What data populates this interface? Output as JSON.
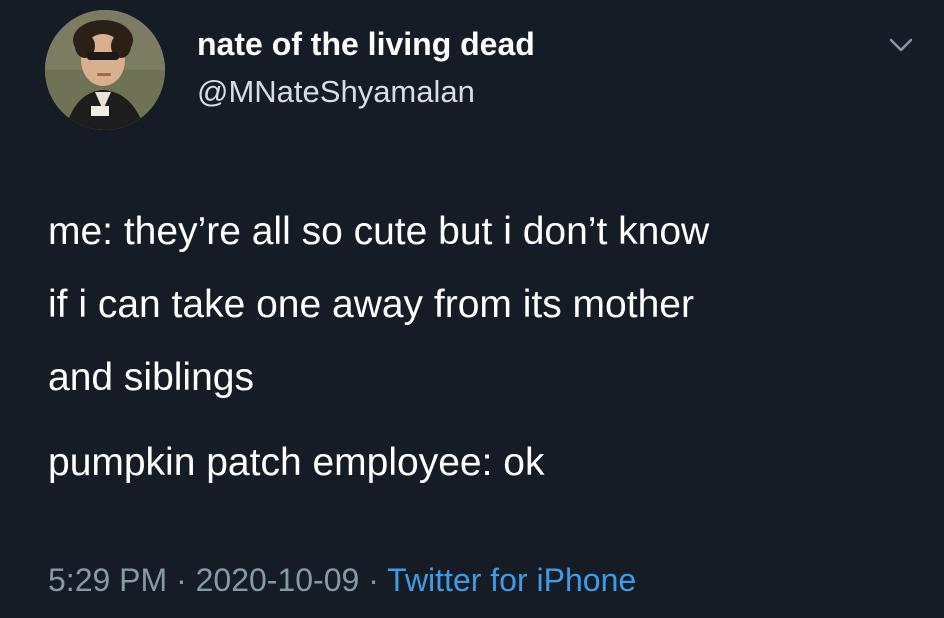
{
  "user": {
    "display_name": "nate of the living dead",
    "handle": "@MNateShyamalan"
  },
  "tweet": {
    "lines_para1": [
      "me: they’re all so cute but i don’t know",
      "if i can take one away from its mother",
      "and siblings"
    ],
    "para2": "pumpkin patch employee: ok"
  },
  "meta": {
    "time": "5:29 PM",
    "separator": "·",
    "date": "2020-10-09",
    "source": "Twitter for iPhone"
  },
  "colors": {
    "background": "#151c26",
    "text": "#ffffff",
    "meta": "#8899a6",
    "link": "#3e9ce6"
  },
  "icons": {
    "menu": "chevron-down-icon"
  }
}
